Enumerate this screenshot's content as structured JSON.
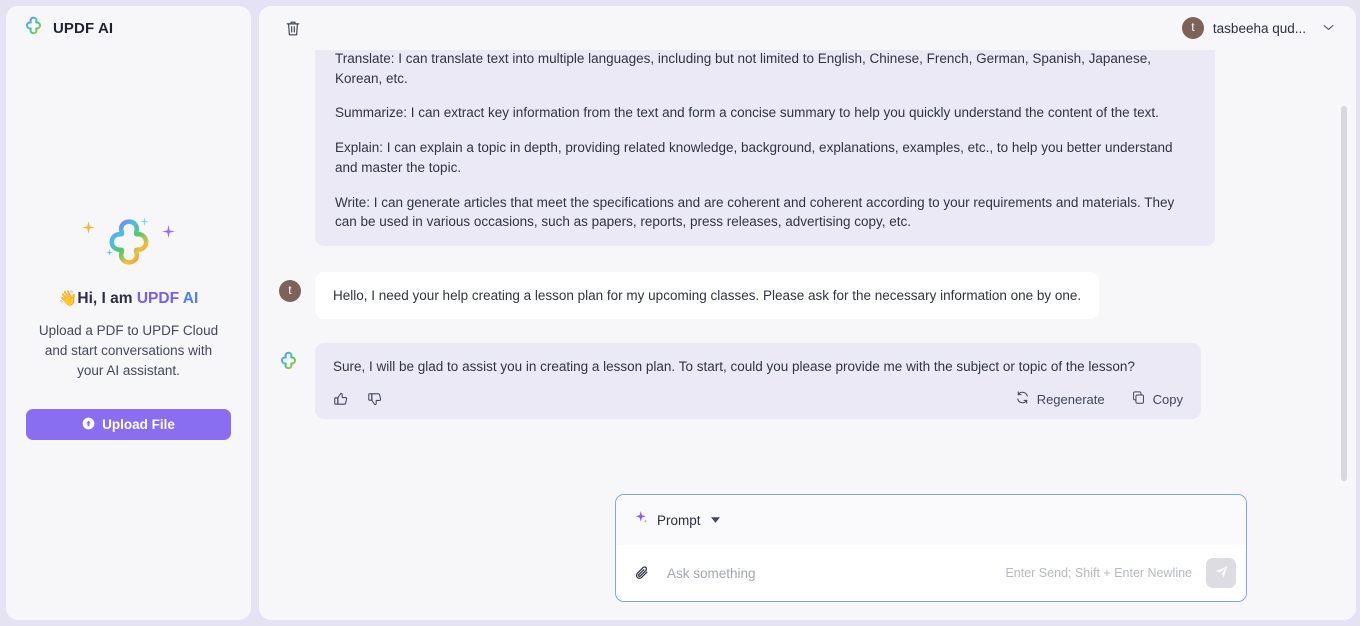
{
  "sidebar": {
    "brand": "UPDF AI",
    "brand_logo_icon": "updf-clover-logo-icon",
    "hero": {
      "logo_icon": "updf-clover-logo-large-icon",
      "wave_emoji": "👋",
      "greeting_prefix": "Hi, I am ",
      "greeting_brand": "UPDF ",
      "greeting_brand_ai": "AI",
      "description": "Upload a PDF to UPDF Cloud and start conversations with your AI assistant."
    },
    "upload_button": {
      "label": "Upload File",
      "icon": "upload-arrow-icon",
      "color": "#8a6ef2"
    }
  },
  "topbar": {
    "delete_icon": "trash-icon",
    "user": {
      "avatar_initial": "t",
      "avatar_color": "#7d6259",
      "name": "tasbeeha qud...",
      "caret_icon": "chevron-down-icon"
    }
  },
  "chat": {
    "messages": [
      {
        "role": "assistant",
        "paragraphs": [
          "Translate: I can translate text into multiple languages, including but not limited to English, Chinese, French, German, Spanish, Japanese, Korean, etc.",
          "Summarize: I can extract key information from the text and form a concise summary to help you quickly understand the content of the text.",
          "Explain: I can explain a topic in depth, providing related knowledge, background, explanations, examples, etc., to help you better understand and master the topic.",
          "Write: I can generate articles that meet the specifications and are coherent and coherent according to your requirements and materials. They can be used in various occasions, such as papers, reports, press releases, advertising copy, etc."
        ]
      },
      {
        "role": "user",
        "avatar_initial": "t",
        "text": "Hello, I need your help creating a lesson plan for my upcoming classes. Please ask for the necessary information one by one."
      },
      {
        "role": "assistant",
        "text": "Sure, I will be glad to assist you in creating a lesson plan. To start, could you please provide me with the subject or topic of the lesson?",
        "actions": {
          "thumbs_up_icon": "thumbs-up-icon",
          "thumbs_down_icon": "thumbs-down-icon",
          "regenerate_label": "Regenerate",
          "regenerate_icon": "refresh-icon",
          "copy_label": "Copy",
          "copy_icon": "copy-icon"
        }
      }
    ]
  },
  "composer": {
    "prompt_label": "Prompt",
    "prompt_icon": "sparkle-icon",
    "prompt_caret_icon": "caret-down-icon",
    "attach_icon": "paperclip-icon",
    "input_value": "",
    "input_placeholder": "Ask something",
    "hint": "Enter Send; Shift + Enter Newline",
    "send_icon": "send-plane-icon",
    "border_color": "#7ea6d6"
  },
  "colors": {
    "page_background": "#e4e2f3",
    "panel": "#f7f7fa",
    "assistant_bubble": "#ebe9f6",
    "user_bubble": "#ffffff",
    "accent_purple": "#7b5cf0",
    "accent_blue": "#4d7ef7"
  }
}
